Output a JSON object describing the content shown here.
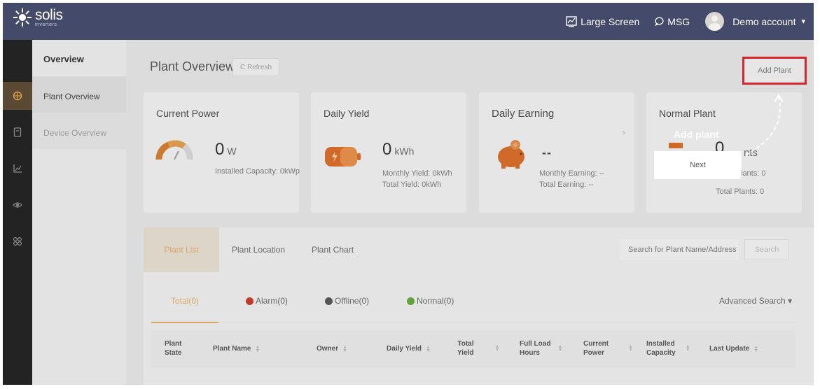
{
  "brand": {
    "name": "solis",
    "tagline": "inverters"
  },
  "topbar": {
    "large_screen": "Large Screen",
    "msg": "MSG",
    "account": "Demo account",
    "account_caret": "▾"
  },
  "submenu": {
    "header": "Overview",
    "items": [
      {
        "label": "Plant Overview",
        "active": true
      },
      {
        "label": "Device Overview",
        "active": false
      }
    ]
  },
  "page": {
    "title": "Plant Overview",
    "refresh": "C Refresh",
    "add_plant": "Add Plant"
  },
  "cards": {
    "current_power": {
      "title": "Current Power",
      "value": "0",
      "unit": "W",
      "line1": "Installed Capacity: 0kWp"
    },
    "daily_yield": {
      "title": "Daily Yield",
      "value": "0",
      "unit": "kWh",
      "line1": "Monthly Yield: 0kWh",
      "line2": "Total Yield: 0kWh"
    },
    "daily_earning": {
      "title": "Daily Earning",
      "value": "--",
      "line1": "Monthly Earning: --",
      "line2": "Total Earning: --",
      "chevron": "›"
    },
    "normal_plant": {
      "title": "Normal Plant",
      "value": "0",
      "unit": "nts",
      "line1": "lants: 0",
      "line2": "Total Plants: 0"
    }
  },
  "tabs": [
    "Plant List",
    "Plant Location",
    "Plant Chart"
  ],
  "search": {
    "placeholder": "Search for Plant Name/Address",
    "button": "Search"
  },
  "filters": {
    "total": "Total(0)",
    "alarm": "Alarm(0)",
    "offline": "Offline(0)",
    "normal": "Normal(0)",
    "advanced": "Advanced Search ▾"
  },
  "table_headers": {
    "plant_state": [
      "Plant",
      "State"
    ],
    "plant_name": "Plant Name",
    "owner": "Owner",
    "daily_yield": "Daily Yield",
    "total_yield": [
      "Total",
      "Yield"
    ],
    "full_load_hours": [
      "Full Load",
      "Hours"
    ],
    "current_power": [
      "Current",
      "Power"
    ],
    "installed_capacity": [
      "Installed",
      "Capacity"
    ],
    "last_update": "Last Update"
  },
  "tour": {
    "label": "Add plant",
    "next": "Next"
  },
  "colors": {
    "topbar": "#444b6a",
    "accent": "#d9a66a",
    "highlight": "#d8242c",
    "alarm": "#c0392b",
    "offline": "#555555",
    "normal": "#5fa33a"
  },
  "icons": {
    "rail": [
      "plant-icon",
      "device-icon",
      "chart-icon",
      "eye-icon",
      "apps-icon"
    ],
    "topbar": [
      "large-screen-icon",
      "message-icon"
    ]
  }
}
